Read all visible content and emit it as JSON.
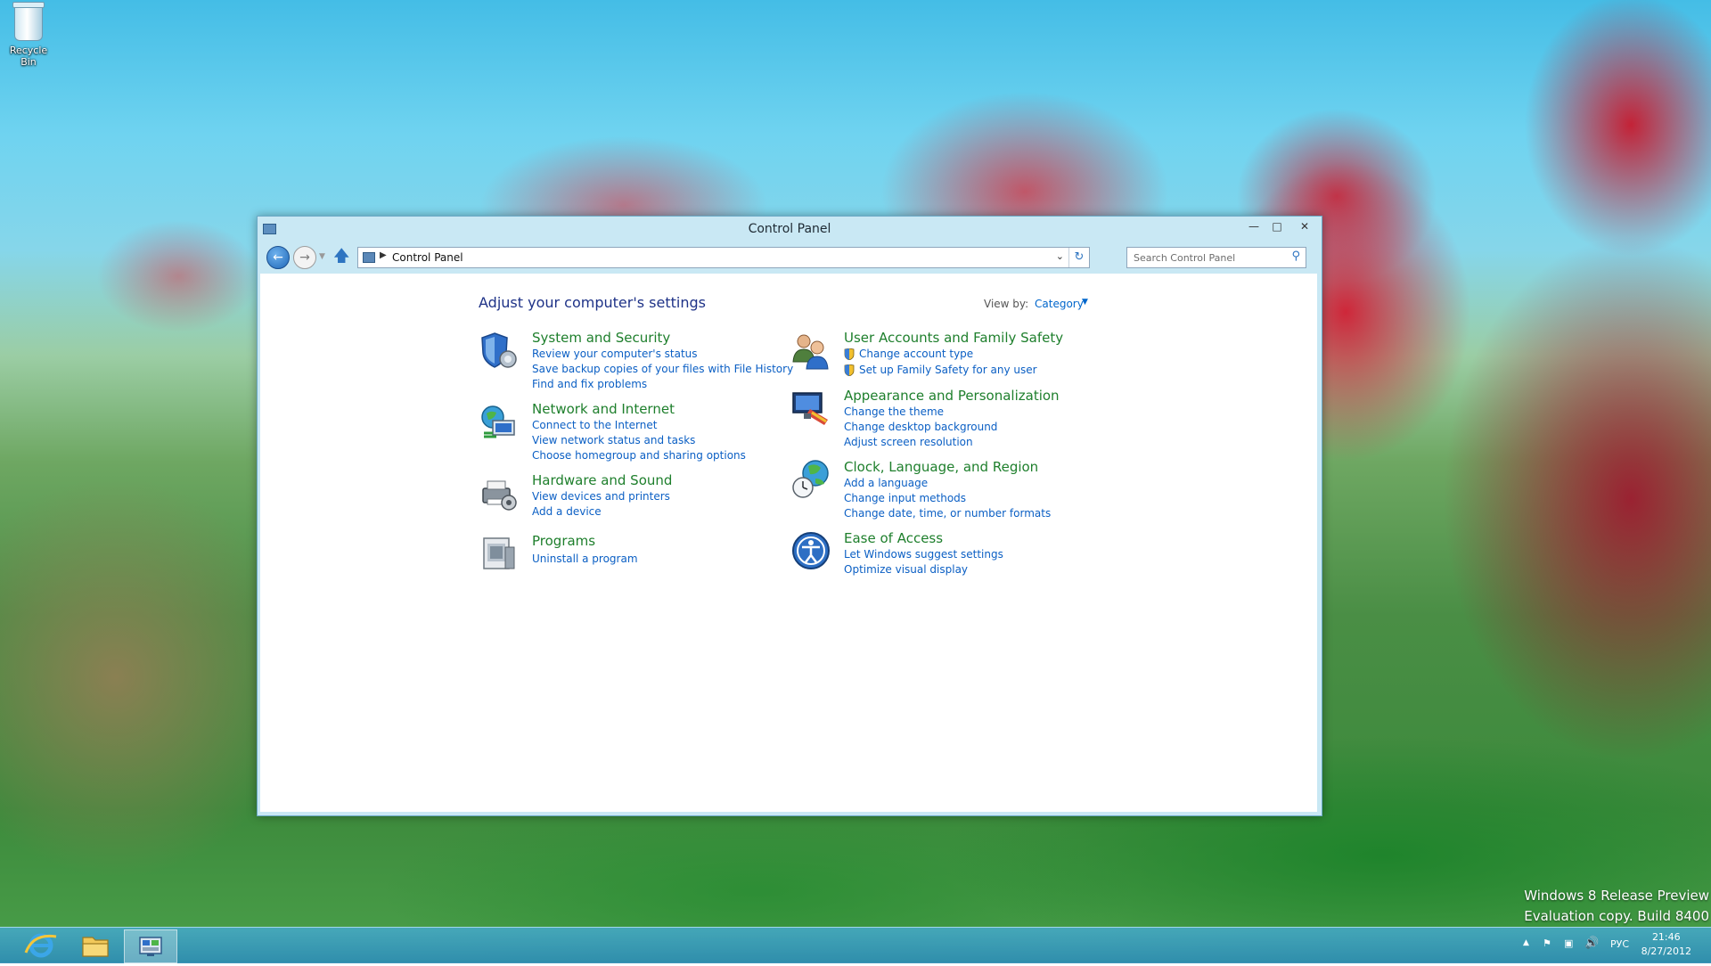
{
  "desktop": {
    "recycle_bin_label": "Recycle Bin",
    "watermark_line1": "Windows 8 Release Preview",
    "watermark_line2": "Evaluation copy. Build 8400"
  },
  "window": {
    "title": "Control Panel",
    "minimize_icon": "minimize-icon",
    "maximize_icon": "maximize-icon",
    "close_icon": "close-icon"
  },
  "navigation": {
    "breadcrumb": "Control Panel",
    "search_placeholder": "Search Control Panel"
  },
  "main": {
    "heading": "Adjust your computer's settings",
    "view_by_label": "View by:",
    "view_by_value": "Category"
  },
  "categories": [
    {
      "title": "System and Security",
      "icon": "system-security-shield-icon",
      "links": [
        "Review your computer's status",
        "Save backup copies of your files with File History",
        "Find and fix problems"
      ]
    },
    {
      "title": "Network and Internet",
      "icon": "network-globe-icon",
      "links": [
        "Connect to the Internet",
        "View network status and tasks",
        "Choose homegroup and sharing options"
      ]
    },
    {
      "title": "Hardware and Sound",
      "icon": "printer-speaker-icon",
      "links": [
        "View devices and printers",
        "Add a device"
      ]
    },
    {
      "title": "Programs",
      "icon": "programs-box-icon",
      "links": [
        "Uninstall a program"
      ]
    },
    {
      "title": "User Accounts and Family Safety",
      "icon": "users-icon",
      "links": [
        "Change account type",
        "Set up Family Safety for any user"
      ]
    },
    {
      "title": "Appearance and Personalization",
      "icon": "monitor-palette-icon",
      "links": [
        "Change the theme",
        "Change desktop background",
        "Adjust screen resolution"
      ]
    },
    {
      "title": "Clock, Language, and Region",
      "icon": "clock-globe-icon",
      "links": [
        "Add a language",
        "Change input methods",
        "Change date, time, or number formats"
      ]
    },
    {
      "title": "Ease of Access",
      "icon": "ease-of-access-icon",
      "links": [
        "Let Windows suggest settings",
        "Optimize visual display"
      ]
    }
  ],
  "taskbar": {
    "apps": [
      "internet-explorer-icon",
      "file-explorer-icon",
      "control-panel-icon"
    ],
    "language": "РУС",
    "time": "21:46",
    "date": "8/27/2012"
  },
  "colors": {
    "link": "#0b5fc4",
    "category_title": "#1e7f2c",
    "heading": "#1e3287",
    "window_frame": "#c9e8f4"
  }
}
